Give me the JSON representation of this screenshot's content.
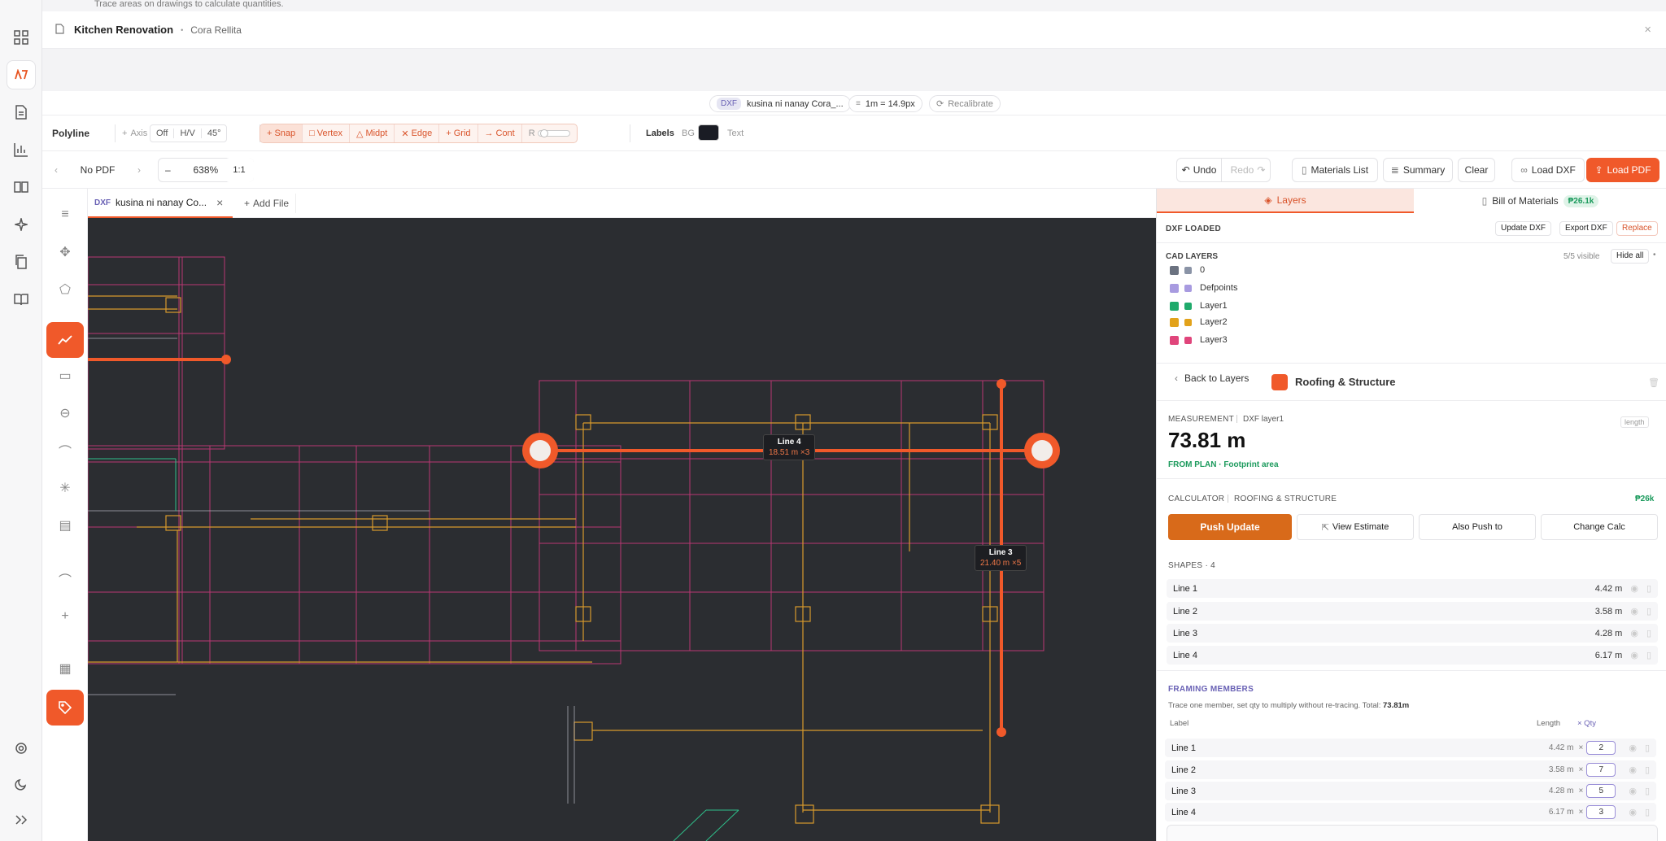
{
  "hint": "Trace areas on drawings to calculate quantities.",
  "title": {
    "project": "Kitchen Renovation",
    "separator": "•",
    "client": "Cora Rellita"
  },
  "fileinfo": {
    "badge": "DXF",
    "filename": "kusina ni nanay Cora_...",
    "scale": "1m = 14.9px",
    "recalibrate": "Recalibrate"
  },
  "drawbar": {
    "mode": "Polyline",
    "axis": "Axis",
    "axis_opts": [
      "Off",
      "H/V",
      "45°"
    ],
    "snaps": [
      "Snap",
      "Vertex",
      "Midpt",
      "Edge",
      "Grid",
      "Cont"
    ],
    "r_label": "R",
    "labels": "Labels",
    "bg": "BG",
    "text": "Text",
    "bg_color": "#1a1c24"
  },
  "nav": {
    "prev": "‹",
    "pdf": "No PDF",
    "next": "›",
    "minus": "–",
    "zoom": "638%",
    "plus": "+",
    "ratio": "1:1",
    "undo": "Undo",
    "redo": "Redo",
    "materials": "Materials List",
    "summary": "Summary",
    "clear": "Clear",
    "load_dxf": "Load DXF",
    "load_pdf": "Load PDF"
  },
  "tabs": {
    "badge": "DXF",
    "file": "kusina ni nanay Co...",
    "close": "×",
    "add": "Add File"
  },
  "canvas": {
    "line4": {
      "name": "Line 4",
      "meas": "18.51 m ×3"
    },
    "line3": {
      "name": "Line 3",
      "meas": "21.40 m ×5"
    }
  },
  "panel": {
    "tab_layers": "Layers",
    "tab_bom": "Bill of Materials",
    "bom_badge": "₱26.1k",
    "dxf_loaded": "DXF LOADED",
    "update_dxf": "Update DXF",
    "export_dxf": "Export DXF",
    "replace": "Replace",
    "cad_layers": "CAD LAYERS",
    "visible": "5/5 visible",
    "hide_all": "Hide all",
    "layers": [
      {
        "name": "0",
        "color": "#8a93a6",
        "check": "#6b7280"
      },
      {
        "name": "Defpoints",
        "color": "#a89be0",
        "check": "#a89be0"
      },
      {
        "name": "Layer1",
        "color": "#1faa6b",
        "check": "#1faa6b"
      },
      {
        "name": "Layer2",
        "color": "#e2a21a",
        "check": "#e2a21a"
      },
      {
        "name": "Layer3",
        "color": "#e0457b",
        "check": "#e0457b"
      }
    ],
    "back": "Back to Layers",
    "group": "Roofing & Structure",
    "group_color": "#f0592a",
    "measurement_label": "MEASUREMENT",
    "measurement_src": "DXF layer1",
    "length_tag": "length",
    "measurement_value": "73.81 m",
    "from_plan": "FROM PLAN · Footprint area",
    "calculator": "CALCULATOR",
    "calc_name": "ROOFING & STRUCTURE",
    "calc_price": "₱26k",
    "push_update": "Push Update",
    "view_estimate": "View Estimate",
    "also_push": "Also Push to",
    "change_calc": "Change Calc",
    "shapes_label": "SHAPES · 4",
    "shapes": [
      {
        "name": "Line 1",
        "len": "4.42 m"
      },
      {
        "name": "Line 2",
        "len": "3.58 m"
      },
      {
        "name": "Line 3",
        "len": "4.28 m"
      },
      {
        "name": "Line 4",
        "len": "6.17 m"
      }
    ],
    "framing_label": "FRAMING MEMBERS",
    "framing_desc": "Trace one member, set qty to multiply without re-tracing. Total:",
    "framing_total": "73.81m",
    "col_label": "Label",
    "col_length": "Length",
    "col_qty": "× Qty",
    "members": [
      {
        "name": "Line 1",
        "len": "4.42 m",
        "qty": "2"
      },
      {
        "name": "Line 2",
        "len": "3.58 m",
        "qty": "7"
      },
      {
        "name": "Line 3",
        "len": "4.28 m",
        "qty": "5"
      },
      {
        "name": "Line 4",
        "len": "6.17 m",
        "qty": "3"
      }
    ]
  }
}
